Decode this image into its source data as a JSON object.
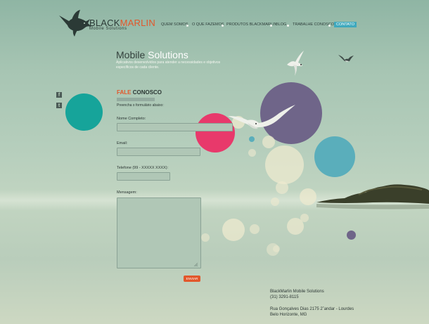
{
  "brand": {
    "name_black": "BLACK",
    "name_orange": "MARLIN",
    "tagline_prefix": "",
    "tagline": "Mobile Solutions",
    "colors": {
      "accent": "#e2572b",
      "nav_active": "#3fa9bd",
      "text": "#2c3734"
    }
  },
  "nav": {
    "items": [
      {
        "label": "QUEM SOMOS"
      },
      {
        "label": "O QUE FAZEMOS"
      },
      {
        "label": "PRODUTOS BLACKMARLIN"
      },
      {
        "label": "BLOG"
      },
      {
        "label": "TRABALHE CONOSCO"
      },
      {
        "label": "CONTATO",
        "active": true
      }
    ]
  },
  "hero": {
    "title_dark": "Mobile",
    "title_light": "Solutions",
    "subtitle": "Aplicativos desenvolvidos para atender a necessidades e objetivos específicos de cada cliente."
  },
  "social": [
    {
      "icon": "facebook-icon",
      "glyph": "f"
    },
    {
      "icon": "twitter-icon",
      "glyph": "t"
    }
  ],
  "form": {
    "title_orange": "FALE",
    "title_dark": "CONOSCO",
    "intro": "Preencha o formulário abaixo:",
    "fields": {
      "name_label": "Nome Completo:",
      "email_label": "Email:",
      "phone_label": "Telefone (99 - XXXXX XXXX):",
      "message_label": "Mensagem:"
    },
    "values": {
      "name": "",
      "email": "",
      "phone": "",
      "message": ""
    },
    "submit_label": "ENVIAR"
  },
  "contact": {
    "company": "BlackMarlin Mobile Solutions",
    "phone": "(31) 3291-8115",
    "address_line1": "Rua Gonçalves Dias 2175 2˚andar - Lourdes",
    "address_line2": "Belo Horizonte, MG"
  },
  "decor_colors": {
    "teal": "#16a49a",
    "pink": "#e8396b",
    "purple": "#6f6589",
    "blue": "#5aaebb",
    "pale": "#eee9cf"
  }
}
